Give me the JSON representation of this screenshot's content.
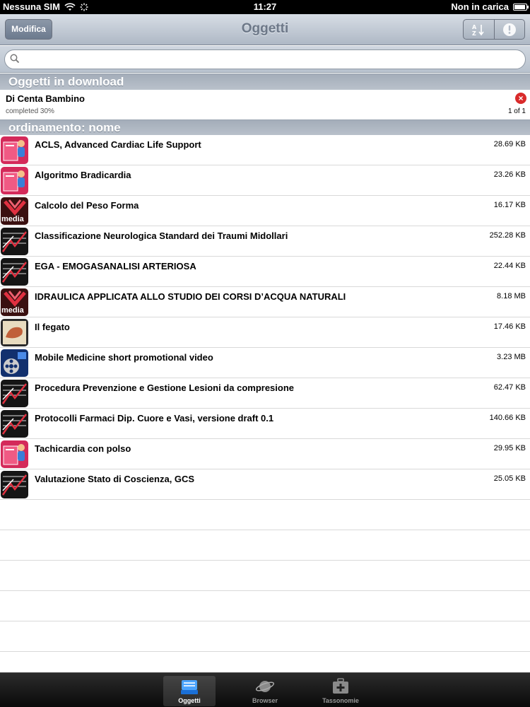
{
  "status_bar": {
    "carrier": "Nessuna SIM",
    "time": "11:27",
    "charge": "Non in carica"
  },
  "nav": {
    "edit_label": "Modifica",
    "title": "Oggetti"
  },
  "search": {
    "placeholder": ""
  },
  "downloads": {
    "header": "Oggetti in download",
    "item": {
      "name": "Di Centa Bambino",
      "status": "completed 30%",
      "count": "1 of 1"
    }
  },
  "sort_header": "ordinamento: nome",
  "items": [
    {
      "label": "ACLS, Advanced Cardiac Life Support",
      "size": "28.69 KB",
      "icon": "book-icon"
    },
    {
      "label": "Algoritmo Bradicardia",
      "size": "23.26 KB",
      "icon": "book-icon"
    },
    {
      "label": "Calcolo del Peso Forma",
      "size": "16.17 KB",
      "icon": "media-icon"
    },
    {
      "label": "Classificazione Neurologica Standard dei Traumi Midollari",
      "size": "252.28 KB",
      "icon": "chart-icon"
    },
    {
      "label": "EGA - EMOGASANALISI ARTERIOSA",
      "size": "22.44 KB",
      "icon": "chart-icon"
    },
    {
      "label": "IDRAULICA APPLICATA ALLO STUDIO DEI CORSI D’ACQUA NATURALI",
      "size": "8.18 MB",
      "icon": "media-icon"
    },
    {
      "label": "Il fegato",
      "size": "17.46 KB",
      "icon": "liver-image-icon"
    },
    {
      "label": "Mobile Medicine short promotional video",
      "size": "3.23 MB",
      "icon": "video-reel-icon"
    },
    {
      "label": "Procedura Prevenzione e Gestione Lesioni da compresione",
      "size": "62.47 KB",
      "icon": "chart-icon"
    },
    {
      "label": "Protocolli Farmaci Dip. Cuore e Vasi, versione draft 0.1",
      "size": "140.66 KB",
      "icon": "chart-icon"
    },
    {
      "label": "Tachicardia con polso",
      "size": "29.95 KB",
      "icon": "book-icon"
    },
    {
      "label": "Valutazione Stato di Coscienza, GCS",
      "size": "25.05 KB",
      "icon": "chart-icon"
    }
  ],
  "media_badge": "media",
  "tabs": [
    {
      "label": "Oggetti",
      "icon": "inbox-tray-icon",
      "selected": true
    },
    {
      "label": "Browser",
      "icon": "planet-icon",
      "selected": false
    },
    {
      "label": "Tassonomie",
      "icon": "first-aid-kit-icon",
      "selected": false
    }
  ]
}
